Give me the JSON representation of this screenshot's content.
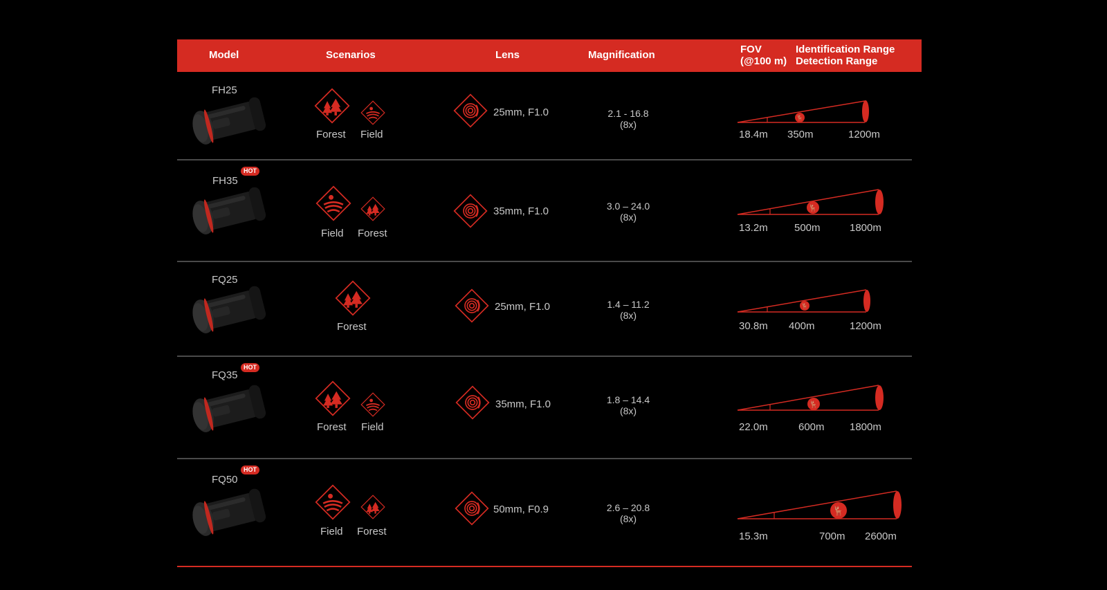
{
  "header": {
    "model": "Model",
    "scenarios": "Scenarios",
    "lens": "Lens",
    "magnification": "Magnification",
    "fov_line1": "FOV",
    "fov_line2": "(@100 m)",
    "identification_range": "Identification Range",
    "detection_range": "Detection Range"
  },
  "hot_label": "HOT",
  "colors": {
    "accent": "#d52b22",
    "text": "#c9c9c9",
    "background": "#000000",
    "divider": "#4a4a4a"
  },
  "rows": [
    {
      "model": "FH25",
      "scenarios": [
        {
          "label": "Forest",
          "icon": "forest-icon"
        },
        {
          "label": "Field",
          "icon": "field-icon"
        }
      ],
      "lens": "25mm, F1.0",
      "magnification": "2.1 - 16.8",
      "zoom": "(8x)",
      "fov": "18.4m",
      "identification": "350m",
      "detection": "1200m"
    },
    {
      "model": "FH35",
      "scenarios": [
        {
          "label": "Field",
          "icon": "field-icon"
        },
        {
          "label": "Forest",
          "icon": "forest-icon"
        }
      ],
      "lens": "35mm, F1.0",
      "magnification": "3.0 – 24.0",
      "zoom": "(8x)",
      "fov": "13.2m",
      "identification": "500m",
      "detection": "1800m"
    },
    {
      "model": "FQ25",
      "scenarios": [
        {
          "label": "Forest",
          "icon": "forest-icon"
        }
      ],
      "lens": "25mm, F1.0",
      "magnification": "1.4 – 11.2",
      "zoom": "(8x)",
      "fov": "30.8m",
      "identification": "400m",
      "detection": "1200m"
    },
    {
      "model": "FQ35",
      "scenarios": [
        {
          "label": "Forest",
          "icon": "forest-icon"
        },
        {
          "label": "Field",
          "icon": "field-icon"
        }
      ],
      "lens": "35mm, F1.0",
      "magnification": "1.8 – 14.4",
      "zoom": "(8x)",
      "fov": "22.0m",
      "identification": "600m",
      "detection": "1800m"
    },
    {
      "model": "FQ50",
      "scenarios": [
        {
          "label": "Field",
          "icon": "field-icon"
        },
        {
          "label": "Forest",
          "icon": "forest-icon"
        }
      ],
      "lens": "50mm, F0.9",
      "magnification": "2.6 – 20.8",
      "zoom": "(8x)",
      "fov": "15.3m",
      "identification": "700m",
      "detection": "2600m"
    }
  ]
}
